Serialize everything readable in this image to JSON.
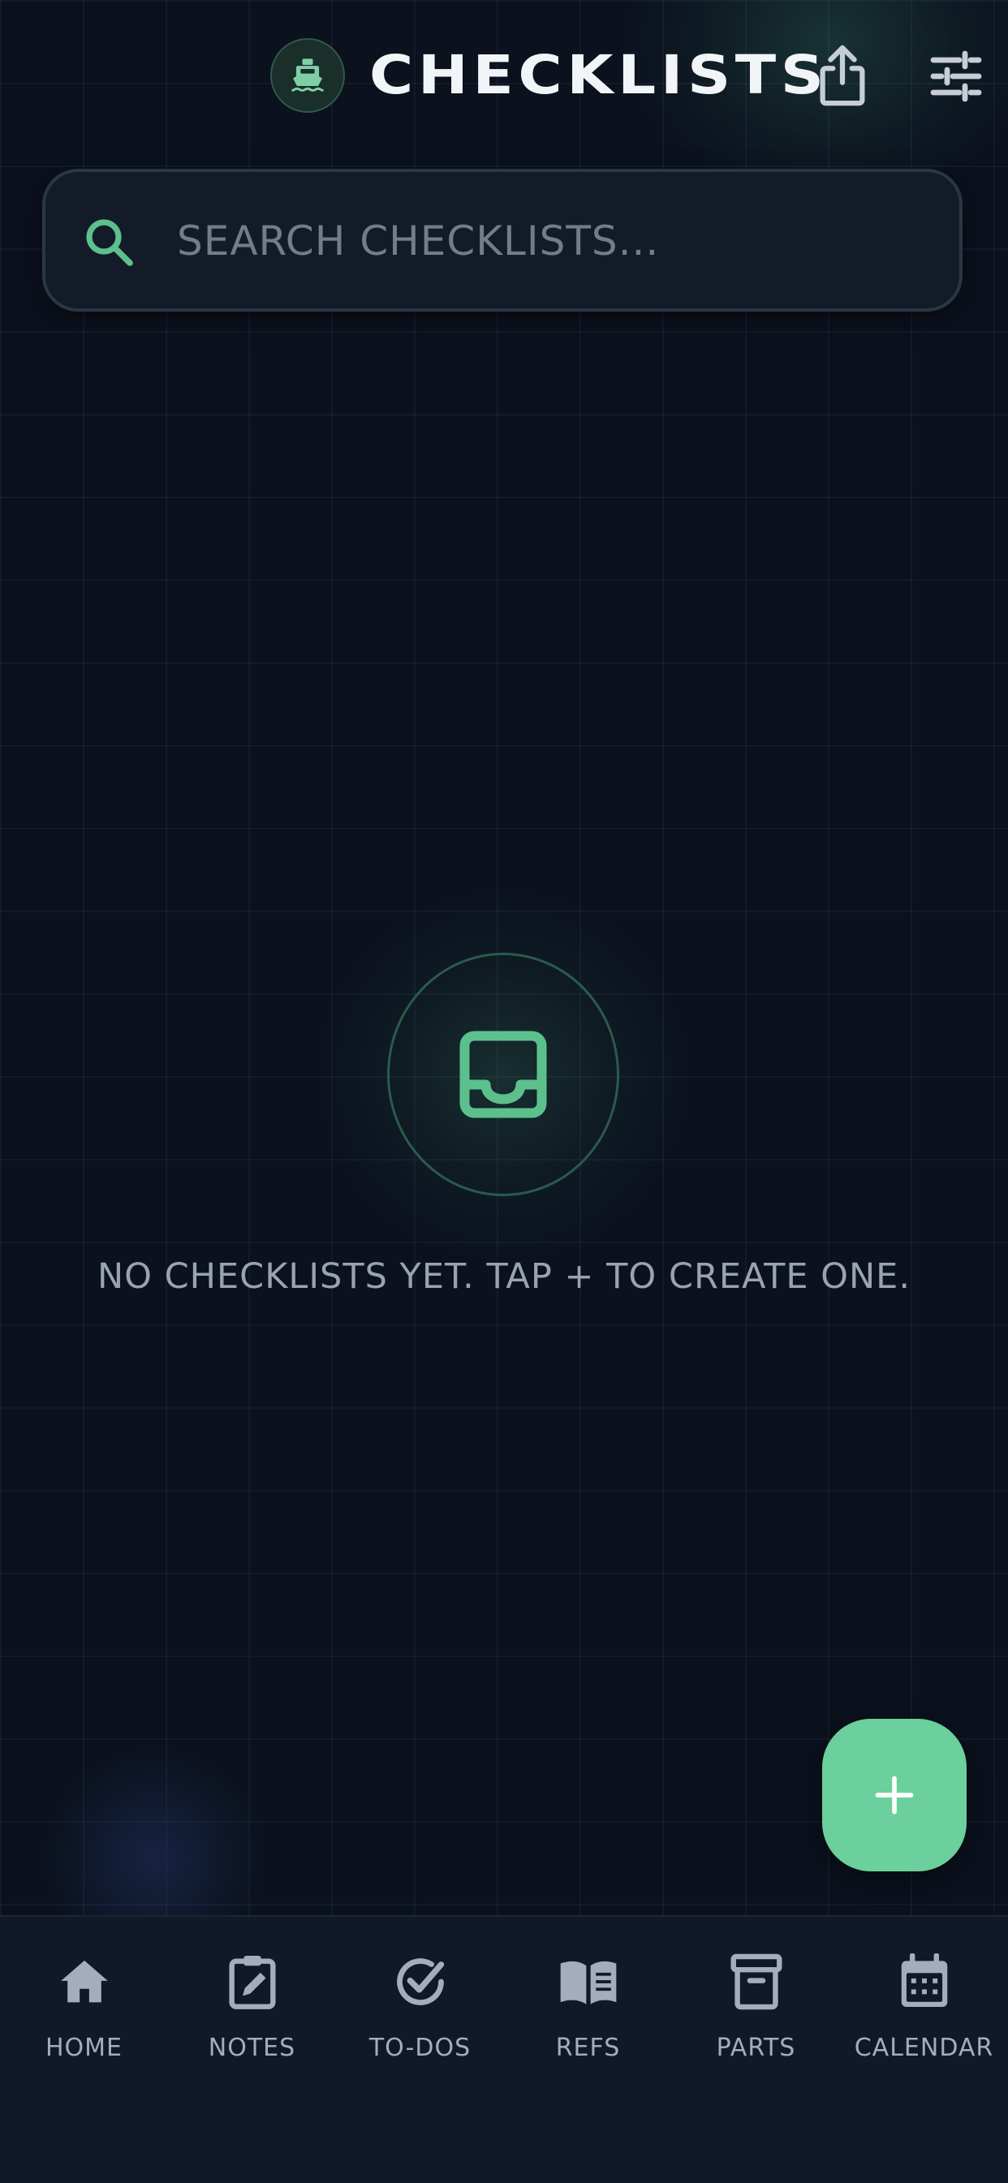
{
  "header": {
    "title": "CHECKLISTS",
    "logo_icon": "ship-icon",
    "share_icon": "share-icon",
    "filter_icon": "sliders-icon"
  },
  "search": {
    "placeholder": "SEARCH CHECKLISTS...",
    "value": ""
  },
  "empty_state": {
    "icon": "inbox-tray-icon",
    "message": "NO CHECKLISTS YET. TAP + TO CREATE ONE."
  },
  "fab": {
    "label": "+",
    "color": "#6bd09b"
  },
  "bottom_nav": {
    "items": [
      {
        "label": "HOME",
        "icon": "home-icon"
      },
      {
        "label": "NOTES",
        "icon": "clipboard-edit-icon"
      },
      {
        "label": "TO-DOS",
        "icon": "check-circle-icon"
      },
      {
        "label": "REFS",
        "icon": "book-icon"
      },
      {
        "label": "PARTS",
        "icon": "archive-box-icon"
      },
      {
        "label": "CALENDAR",
        "icon": "calendar-icon"
      }
    ]
  },
  "colors": {
    "background": "#0b111d",
    "accent": "#6bd09b",
    "nav_background": "#111827"
  }
}
